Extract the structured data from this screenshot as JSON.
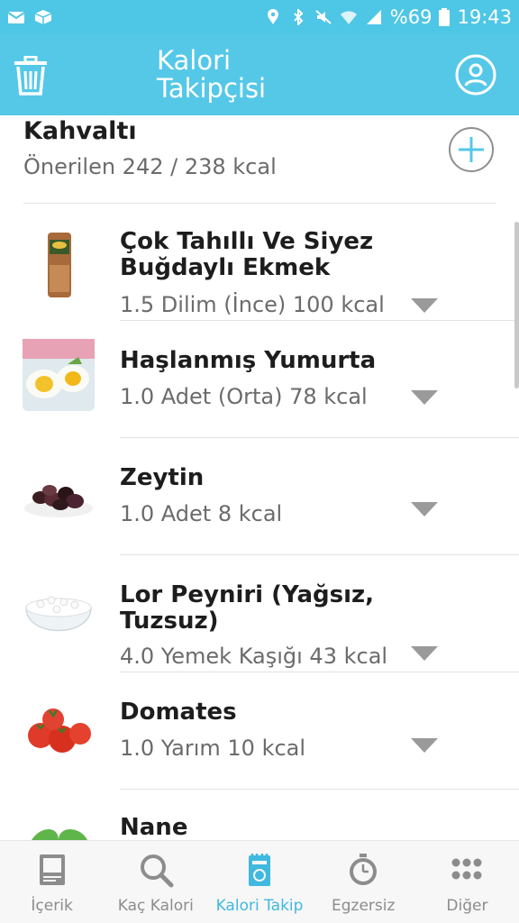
{
  "status_bar": {
    "battery": "%69",
    "time": "19:43"
  },
  "app_bar": {
    "title_line1": "Kalori",
    "title_line2": "Takipçisi"
  },
  "meal": {
    "title": "Kahvaltı",
    "subtitle": "Önerilen 242 / 238 kcal"
  },
  "foods": [
    {
      "name": "Çok Tahıllı Ve Siyez Buğdaylı Ekmek",
      "detail": "1.5 Dilim (İnce) 100 kcal",
      "image": "bread-image"
    },
    {
      "name": "Haşlanmış Yumurta",
      "detail": "1.0 Adet (Orta) 78 kcal",
      "image": "egg-image"
    },
    {
      "name": "Zeytin",
      "detail": "1.0 Adet 8 kcal",
      "image": "olive-image"
    },
    {
      "name": "Lor Peyniri (Yağsız, Tuzsuz)",
      "detail": "4.0 Yemek Kaşığı 43 kcal",
      "image": "cheese-image"
    },
    {
      "name": "Domates",
      "detail": "1.0 Yarım 10 kcal",
      "image": "tomato-image"
    },
    {
      "name": "Nane",
      "detail": "",
      "image": "mint-image"
    }
  ],
  "bottom_nav": [
    {
      "label": "İçerik",
      "icon": "book-icon",
      "active": false
    },
    {
      "label": "Kaç Kalori",
      "icon": "search-icon",
      "active": false
    },
    {
      "label": "Kalori Takip",
      "icon": "notebook-icon",
      "active": true
    },
    {
      "label": "Egzersiz",
      "icon": "stopwatch-icon",
      "active": false
    },
    {
      "label": "Diğer",
      "icon": "grid-icon",
      "active": false
    }
  ],
  "colors": {
    "accent": "#55c8e8",
    "active_nav": "#3fb9df"
  }
}
